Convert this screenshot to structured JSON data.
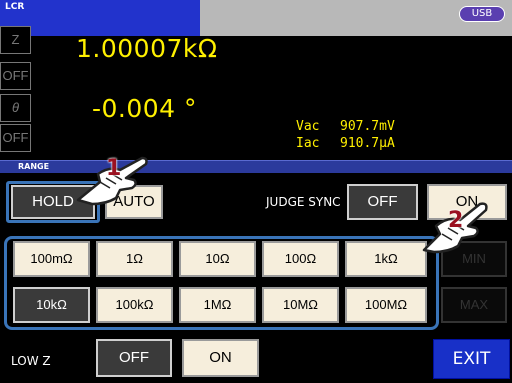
{
  "header": {
    "title": "LCR",
    "usb": "USB"
  },
  "display": {
    "param1_label": "Z",
    "param1_value": "1.00007kΩ",
    "param2_label": "OFF",
    "param3_label": "θ",
    "param3_value": "-0.004 °",
    "param4_label": "OFF",
    "vac_label": "Vac",
    "vac_value": "907.7mV",
    "iac_label": "Iac",
    "iac_value": "910.7μA"
  },
  "range": {
    "section_label": "RANGE",
    "hold": "HOLD",
    "auto": "AUTO",
    "row1": [
      "100mΩ",
      "1Ω",
      "10Ω",
      "100Ω",
      "1kΩ"
    ],
    "row2": [
      "10kΩ",
      "100kΩ",
      "1MΩ",
      "10MΩ",
      "100MΩ"
    ]
  },
  "judge_sync": {
    "label": "JUDGE SYNC",
    "off": "OFF",
    "on": "ON"
  },
  "side_buttons": {
    "min": "MIN",
    "max": "MAX"
  },
  "low_z": {
    "label": "LOW Z",
    "off": "OFF",
    "on": "ON"
  },
  "exit": "EXIT",
  "callouts": {
    "one": "1",
    "two": "2"
  },
  "colors": {
    "lcd_text": "#fff000",
    "outline": "#3a74b8",
    "exit": "#1830c8",
    "callout_red": "#9a1020"
  }
}
